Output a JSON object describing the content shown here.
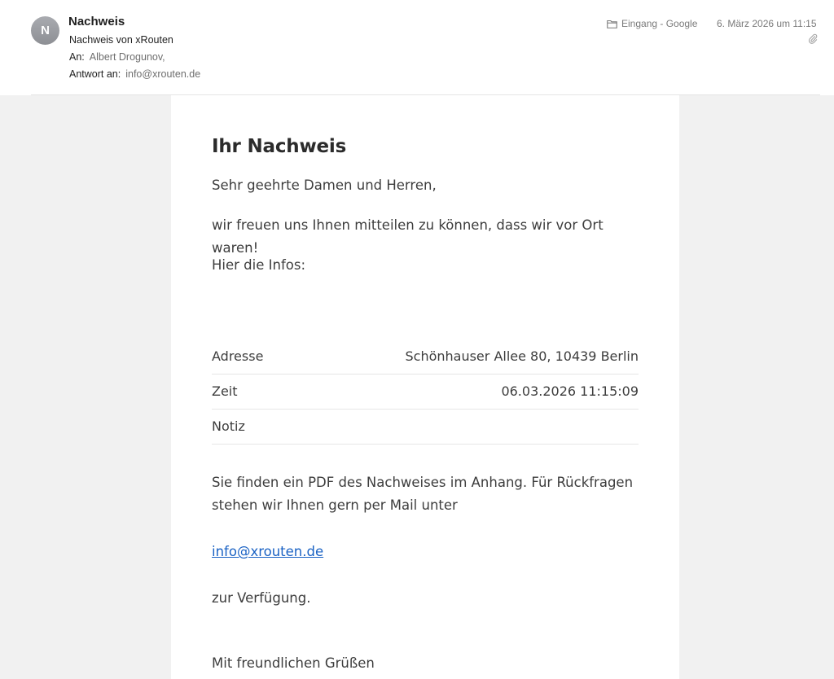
{
  "header": {
    "avatar_letter": "N",
    "sender_name": "Nachweis",
    "subject": "Nachweis von xRouten",
    "to_label": "An:",
    "to_value": "Albert Drogunov,",
    "reply_label": "Antwort an:",
    "reply_value": "info@xrouten.de",
    "mailbox": "Eingang - Google",
    "mailbox_icon": "folder-icon",
    "date": "6. März 2026 um 11:15",
    "attachment_icon": "paperclip-icon"
  },
  "body": {
    "title": "Ihr Nachweis",
    "greeting": "Sehr geehrte Damen und Herren,",
    "intro": "wir freuen uns Ihnen mitteilen zu können, dass wir vor Ort waren!",
    "infos_label": "Hier die Infos:",
    "table": [
      {
        "label": "Adresse",
        "value": "Schönhauser Allee 80, 10439 Berlin"
      },
      {
        "label": "Zeit",
        "value": "06.03.2026 11:15:09"
      },
      {
        "label": "Notiz",
        "value": ""
      }
    ],
    "pdf_text": "Sie finden ein PDF des Nachweises im Anhang. Für Rückfragen stehen wir Ihnen gern per Mail unter",
    "email_link": "info@xrouten.de",
    "available_text": "zur Verfügung.",
    "regards": "Mit freundlichen Grüßen"
  },
  "colors": {
    "link": "#1a62c4",
    "avatar": "#9a9ca1",
    "body_background": "#f1f1f1"
  }
}
